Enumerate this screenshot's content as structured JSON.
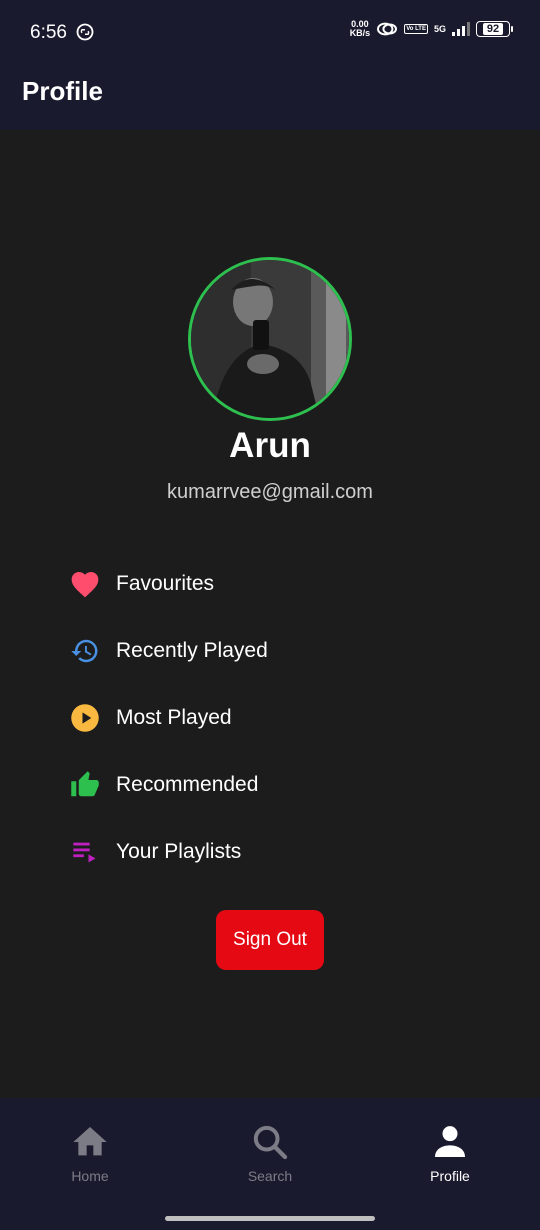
{
  "status_bar": {
    "time": "6:56",
    "net_speed_value": "0.00",
    "net_speed_unit": "KB/s",
    "volte_badge": "Vo LTE",
    "network": "5G",
    "battery": "92"
  },
  "app_bar": {
    "title": "Profile"
  },
  "profile": {
    "name": "Arun",
    "email": "kumarrvee@gmail.com"
  },
  "menu": {
    "items": [
      {
        "label": "Favourites",
        "icon": "heart-icon",
        "color": "#ff4d6d"
      },
      {
        "label": "Recently Played",
        "icon": "history-icon",
        "color": "#4a90e2"
      },
      {
        "label": "Most Played",
        "icon": "play-circle-icon",
        "color": "#f9b940"
      },
      {
        "label": "Recommended",
        "icon": "thumbs-up-icon",
        "color": "#2ec04f"
      },
      {
        "label": "Your Playlists",
        "icon": "playlist-icon",
        "color": "#c020c0"
      }
    ]
  },
  "signout": {
    "label": "Sign Out",
    "color": "#e50914"
  },
  "bottom_nav": {
    "tabs": [
      {
        "label": "Home",
        "icon": "home-icon",
        "active": false
      },
      {
        "label": "Search",
        "icon": "search-icon",
        "active": false
      },
      {
        "label": "Profile",
        "icon": "person-icon",
        "active": true
      }
    ]
  }
}
